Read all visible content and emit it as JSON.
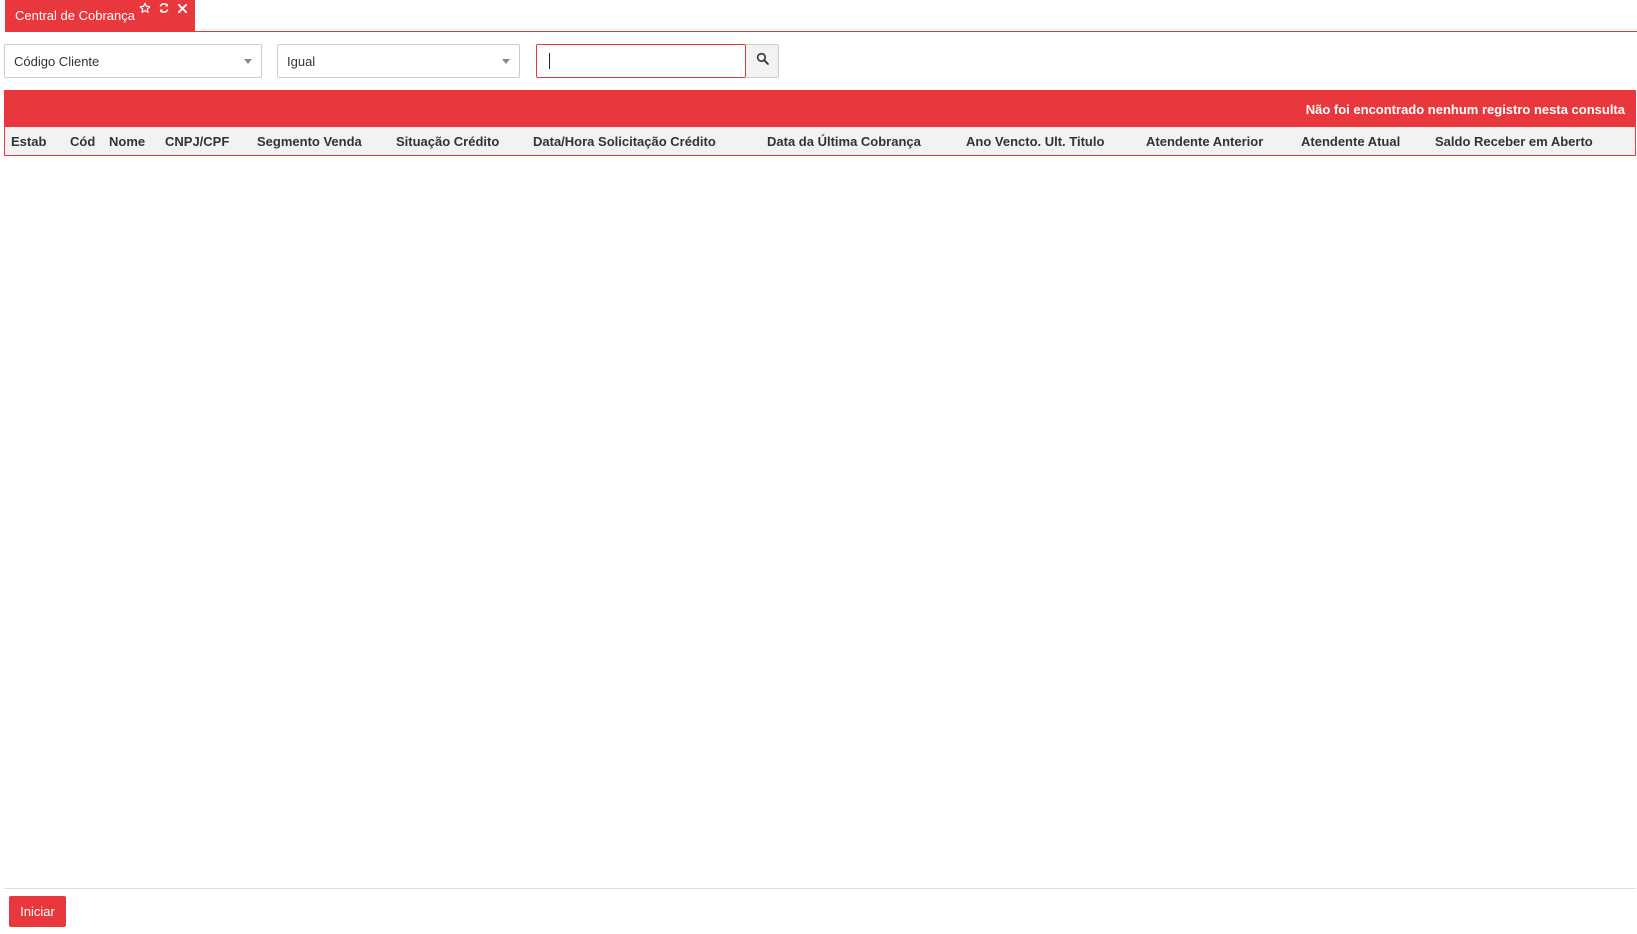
{
  "tab": {
    "title": "Central de Cobrança",
    "icons": [
      "star-icon",
      "refresh-icon",
      "close-icon"
    ]
  },
  "filters": {
    "field_select": {
      "selected": "Código Cliente"
    },
    "operator_select": {
      "selected": "Igual"
    },
    "search_input": {
      "value": ""
    },
    "search_button_icon": "search-icon"
  },
  "grid": {
    "message": "Não foi encontrado nenhum registro nesta consulta",
    "columns": [
      "Estab",
      "Cód",
      "Nome",
      "CNPJ/CPF",
      "Segmento Venda",
      "Situação Crédito",
      "Data/Hora Solicitação Crédito",
      "Data da Última Cobrança",
      "Ano Vencto. Ult. Titulo",
      "Atendente Anterior",
      "Atendente Atual",
      "Saldo Receber em Aberto"
    ]
  },
  "footer": {
    "start_label": "Iniciar"
  },
  "colors": {
    "accent": "#e8383d",
    "header_bg": "#f2f2f2"
  }
}
